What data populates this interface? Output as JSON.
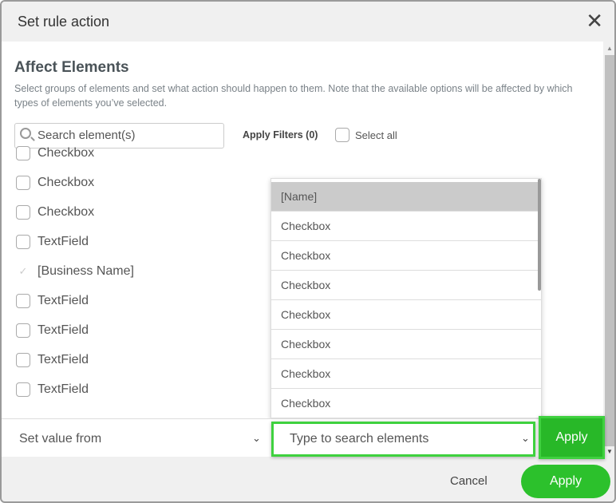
{
  "dialog": {
    "title": "Set rule action"
  },
  "section": {
    "heading": "Affect Elements",
    "description": "Select groups of elements and set what action should happen to them. Note that the available options will be affected by which types of elements you’ve selected."
  },
  "search": {
    "placeholder": "Search element(s)",
    "value": ""
  },
  "filters": {
    "apply_label": "Apply Filters (0)",
    "select_all_label": "Select all"
  },
  "elements": [
    {
      "label": "Checkbox",
      "checked": false
    },
    {
      "label": "Checkbox",
      "checked": false
    },
    {
      "label": "Checkbox",
      "checked": false
    },
    {
      "label": "TextField",
      "checked": false
    },
    {
      "label": "[Business Name]",
      "checked": true
    },
    {
      "label": "TextField",
      "checked": false
    },
    {
      "label": "TextField",
      "checked": false
    },
    {
      "label": "TextField",
      "checked": false
    },
    {
      "label": "TextField",
      "checked": false
    }
  ],
  "dropdown": {
    "options": [
      "[Name]",
      "Checkbox",
      "Checkbox",
      "Checkbox",
      "Checkbox",
      "Checkbox",
      "Checkbox",
      "Checkbox"
    ],
    "highlighted": "[Name]"
  },
  "action_bar": {
    "action_select": "Set value from",
    "element_select_placeholder": "Type to search elements",
    "apply_label": "Apply"
  },
  "footer": {
    "cancel_label": "Cancel",
    "apply_label": "Apply"
  },
  "colors": {
    "accent": "#2cc12c",
    "highlight_border": "#3fd13f"
  }
}
